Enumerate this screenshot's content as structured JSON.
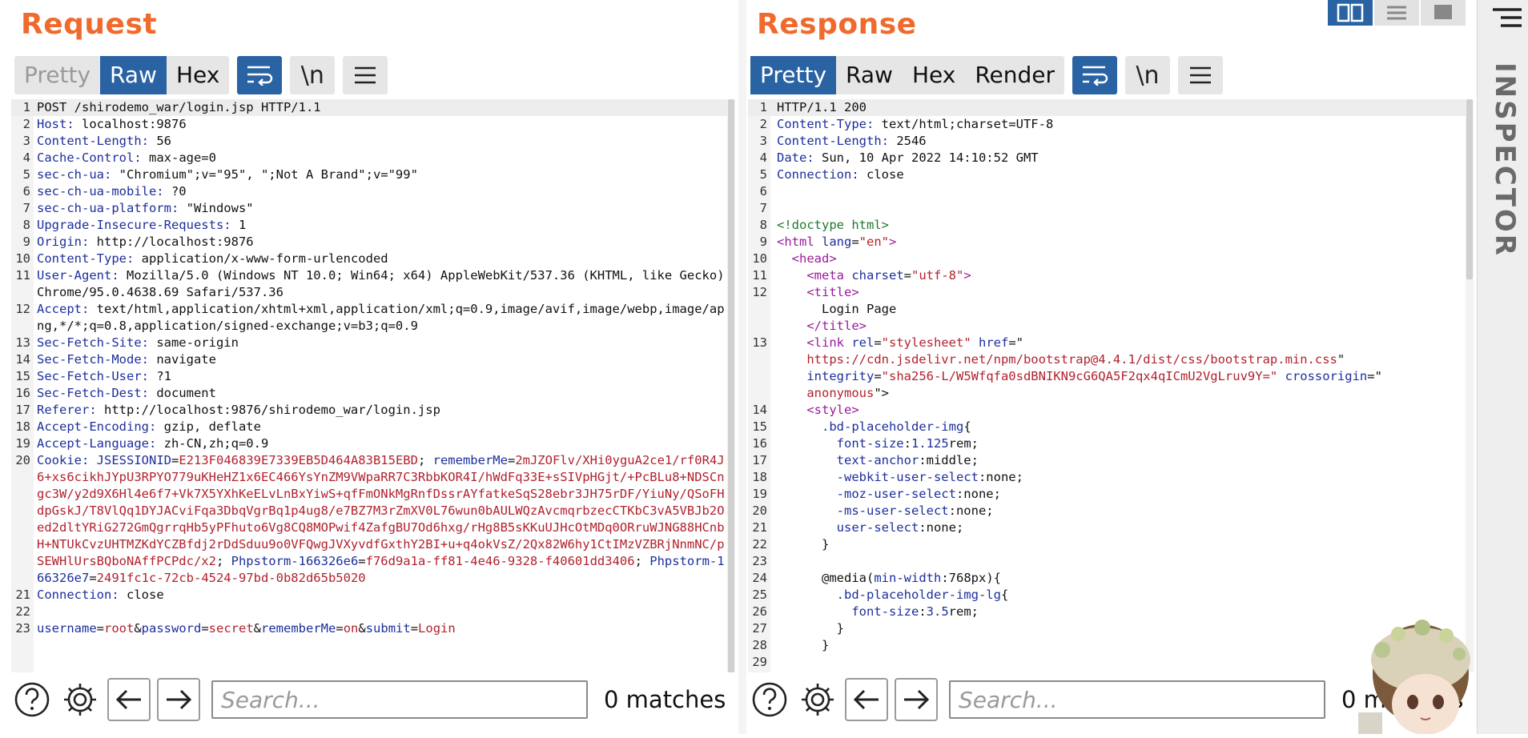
{
  "request": {
    "title": "Request",
    "tabs": [
      {
        "label": "Pretty",
        "state": "disabled"
      },
      {
        "label": "Raw",
        "state": "active"
      },
      {
        "label": "Hex",
        "state": "normal"
      }
    ],
    "newline_label": "\\n",
    "search_placeholder": "Search...",
    "matches": "0 matches"
  },
  "response": {
    "title": "Response",
    "tabs": [
      {
        "label": "Pretty",
        "state": "active"
      },
      {
        "label": "Raw",
        "state": "normal"
      },
      {
        "label": "Hex",
        "state": "normal"
      },
      {
        "label": "Render",
        "state": "normal"
      }
    ],
    "newline_label": "\\n",
    "search_placeholder": "Search...",
    "matches": "0 matches"
  },
  "inspector": {
    "label": "INSPECTOR"
  },
  "request_lines": [
    {
      "n": "1",
      "segs": [
        [
          "v",
          "POST /shirodemo_war/login.jsp HTTP/1.1"
        ]
      ]
    },
    {
      "n": "2",
      "segs": [
        [
          "k",
          "Host:"
        ],
        [
          "v",
          " localhost:9876"
        ]
      ]
    },
    {
      "n": "3",
      "segs": [
        [
          "k",
          "Content-Length:"
        ],
        [
          "v",
          " 56"
        ]
      ]
    },
    {
      "n": "4",
      "segs": [
        [
          "k",
          "Cache-Control:"
        ],
        [
          "v",
          " max-age=0"
        ]
      ]
    },
    {
      "n": "5",
      "segs": [
        [
          "k",
          "sec-ch-ua:"
        ],
        [
          "v",
          " \"Chromium\";v=\"95\", \";Not A Brand\";v=\"99\""
        ]
      ]
    },
    {
      "n": "6",
      "segs": [
        [
          "k",
          "sec-ch-ua-mobile:"
        ],
        [
          "v",
          " ?0"
        ]
      ]
    },
    {
      "n": "7",
      "segs": [
        [
          "k",
          "sec-ch-ua-platform:"
        ],
        [
          "v",
          " \"Windows\""
        ]
      ]
    },
    {
      "n": "8",
      "segs": [
        [
          "k",
          "Upgrade-Insecure-Requests:"
        ],
        [
          "v",
          " 1"
        ]
      ]
    },
    {
      "n": "9",
      "segs": [
        [
          "k",
          "Origin:"
        ],
        [
          "v",
          " http://localhost:9876"
        ]
      ]
    },
    {
      "n": "10",
      "segs": [
        [
          "k",
          "Content-Type:"
        ],
        [
          "v",
          " application/x-www-form-urlencoded"
        ]
      ]
    },
    {
      "n": "11",
      "segs": [
        [
          "k",
          "User-Agent:"
        ],
        [
          "v",
          " Mozilla/5.0 (Windows NT 10.0; Win64; x64) AppleWebKit/537.36 (KHTML, like Gecko) Chrome/95.0.4638.69 Safari/537.36"
        ]
      ]
    },
    {
      "n": "12",
      "segs": [
        [
          "k",
          "Accept:"
        ],
        [
          "v",
          " text/html,application/xhtml+xml,application/xml;q=0.9,image/avif,image/webp,image/apng,*/*;q=0.8,application/signed-exchange;v=b3;q=0.9"
        ]
      ]
    },
    {
      "n": "13",
      "segs": [
        [
          "k",
          "Sec-Fetch-Site:"
        ],
        [
          "v",
          " same-origin"
        ]
      ]
    },
    {
      "n": "14",
      "segs": [
        [
          "k",
          "Sec-Fetch-Mode:"
        ],
        [
          "v",
          " navigate"
        ]
      ]
    },
    {
      "n": "15",
      "segs": [
        [
          "k",
          "Sec-Fetch-User:"
        ],
        [
          "v",
          " ?1"
        ]
      ]
    },
    {
      "n": "16",
      "segs": [
        [
          "k",
          "Sec-Fetch-Dest:"
        ],
        [
          "v",
          " document"
        ]
      ]
    },
    {
      "n": "17",
      "segs": [
        [
          "k",
          "Referer:"
        ],
        [
          "v",
          " http://localhost:9876/shirodemo_war/login.jsp"
        ]
      ]
    },
    {
      "n": "18",
      "segs": [
        [
          "k",
          "Accept-Encoding:"
        ],
        [
          "v",
          " gzip, deflate"
        ]
      ]
    },
    {
      "n": "19",
      "segs": [
        [
          "k",
          "Accept-Language:"
        ],
        [
          "v",
          " zh-CN,zh;q=0.9"
        ]
      ]
    },
    {
      "n": "20",
      "segs": [
        [
          "k",
          "Cookie:"
        ],
        [
          "v",
          " "
        ],
        [
          "ck",
          "JSESSIONID"
        ],
        [
          "v",
          "="
        ],
        [
          "cv",
          "E213F046839E7339EB5D464A83B15EBD"
        ],
        [
          "v",
          "; "
        ],
        [
          "ck",
          "rememberMe"
        ],
        [
          "v",
          "="
        ],
        [
          "cv",
          "2mJZOFlv/XHi0yguA2ce1/rf0R4J6+xs6cikhJYpU3RPYO779uKHeHZ1x6EC466YsYnZM9VWpaRR7C3RbbKOR4I/hWdFq33E+sSIVpHGjt/+PcBLu8+NDSCngc3W/y2d9X6Hl4e6f7+Vk7X5YXhKeELvLnBxYiwS+qfFmONkMgRnfDssrAYfatkeSqS28ebr3JH75rDF/YiuNy/QSoFHdpGskJ/T8VlQq1DYJACviFqa3DbqVgrBq1p4ug8/e7BZ7M3rZmXV0L76wun0bAULWQzAvcmqrbzecCTKbC3vA5VBJb2Oed2dltYRiG272GmQgrrqHb5yPFhuto6Vg8CQ8MOPwif4ZafgBU7Od6hxg/rHg8B5sKKuUJHcOtMDq0ORruWJNG88HCnbH+NTUkCvzUHTMZKdYCZBfdj2rDdSduu9o0VFQwgJVXyvdfGxthY2BI+u+q4okVsZ/2Qx82W6hy1CtIMzVZBRjNnmNC/pSEWHlUrsBQboNAffPCPdc/x2"
        ],
        [
          "v",
          "; "
        ],
        [
          "ck",
          "Phpstorm-166326e6"
        ],
        [
          "v",
          "="
        ],
        [
          "cv",
          "f76d9a1a-ff81-4e46-9328-f40601dd3406"
        ],
        [
          "v",
          "; "
        ],
        [
          "ck",
          "Phpstorm-166326e7"
        ],
        [
          "v",
          "="
        ],
        [
          "cv",
          "2491fc1c-72cb-4524-97bd-0b82d65b5020"
        ]
      ]
    },
    {
      "n": "21",
      "segs": [
        [
          "k",
          "Connection:"
        ],
        [
          "v",
          " close"
        ]
      ]
    },
    {
      "n": "22",
      "segs": [
        [
          "v",
          ""
        ]
      ]
    },
    {
      "n": "23",
      "segs": [
        [
          "ck",
          "username"
        ],
        [
          "v",
          "="
        ],
        [
          "cv",
          "root"
        ],
        [
          "v",
          "&"
        ],
        [
          "ck",
          "password"
        ],
        [
          "v",
          "="
        ],
        [
          "cv",
          "secret"
        ],
        [
          "v",
          "&"
        ],
        [
          "ck",
          "rememberMe"
        ],
        [
          "v",
          "="
        ],
        [
          "cv",
          "on"
        ],
        [
          "v",
          "&"
        ],
        [
          "ck",
          "submit"
        ],
        [
          "v",
          "="
        ],
        [
          "cv",
          "Login"
        ]
      ]
    }
  ],
  "response_lines": [
    {
      "n": "1",
      "segs": [
        [
          "v",
          "HTTP/1.1 200"
        ]
      ]
    },
    {
      "n": "2",
      "segs": [
        [
          "k",
          "Content-Type:"
        ],
        [
          "v",
          " text/html;charset=UTF-8"
        ]
      ]
    },
    {
      "n": "3",
      "segs": [
        [
          "k",
          "Content-Length:"
        ],
        [
          "v",
          " 2546"
        ]
      ]
    },
    {
      "n": "4",
      "segs": [
        [
          "k",
          "Date:"
        ],
        [
          "v",
          " Sun, 10 Apr 2022 14:10:52 GMT"
        ]
      ]
    },
    {
      "n": "5",
      "segs": [
        [
          "k",
          "Connection:"
        ],
        [
          "v",
          " close"
        ]
      ]
    },
    {
      "n": "6",
      "segs": [
        [
          "v",
          ""
        ]
      ]
    },
    {
      "n": "7",
      "segs": [
        [
          "v",
          ""
        ]
      ]
    },
    {
      "n": "8",
      "segs": [
        [
          "doc",
          "<!doctype html>"
        ]
      ]
    },
    {
      "n": "9",
      "segs": [
        [
          "tag",
          "<html "
        ],
        [
          "attr",
          "lang"
        ],
        [
          "txt",
          "="
        ],
        [
          "aval",
          "\"en\""
        ],
        [
          "tag",
          ">"
        ]
      ]
    },
    {
      "n": "10",
      "segs": [
        [
          "txt",
          "  "
        ],
        [
          "tag",
          "<head>"
        ]
      ]
    },
    {
      "n": "11",
      "segs": [
        [
          "txt",
          "    "
        ],
        [
          "tag",
          "<meta "
        ],
        [
          "attr",
          "charset"
        ],
        [
          "txt",
          "="
        ],
        [
          "aval",
          "\"utf-8\""
        ],
        [
          "tag",
          ">"
        ]
      ]
    },
    {
      "n": "12",
      "segs": [
        [
          "txt",
          "    "
        ],
        [
          "tag",
          "<title>"
        ]
      ]
    },
    {
      "n": "",
      "segs": [
        [
          "txt",
          "      Login Page"
        ]
      ]
    },
    {
      "n": "",
      "segs": [
        [
          "txt",
          "    "
        ],
        [
          "tag",
          "</title>"
        ]
      ]
    },
    {
      "n": "13",
      "segs": [
        [
          "txt",
          "    "
        ],
        [
          "tag",
          "<link "
        ],
        [
          "attr",
          "rel"
        ],
        [
          "txt",
          "="
        ],
        [
          "aval",
          "\"stylesheet\""
        ],
        [
          "txt",
          " "
        ],
        [
          "attr",
          "href"
        ],
        [
          "txt",
          "=\""
        ]
      ]
    },
    {
      "n": "",
      "segs": [
        [
          "aval",
          "    https://cdn.jsdelivr.net/npm/bootstrap@4.4.1/dist/css/bootstrap.min.css"
        ],
        [
          "txt",
          "\""
        ]
      ]
    },
    {
      "n": "",
      "segs": [
        [
          "txt",
          "    "
        ],
        [
          "attr",
          "integrity"
        ],
        [
          "txt",
          "="
        ],
        [
          "aval",
          "\"sha256-L/W5Wfqfa0sdBNIKN9cG6QA5F2qx4qICmU2VgLruv9Y=\""
        ],
        [
          "txt",
          " "
        ],
        [
          "attr",
          "crossorigin"
        ],
        [
          "txt",
          "=\""
        ]
      ]
    },
    {
      "n": "",
      "segs": [
        [
          "aval",
          "    anonymous"
        ],
        [
          "txt",
          "\">"
        ]
      ]
    },
    {
      "n": "14",
      "segs": [
        [
          "txt",
          "    "
        ],
        [
          "tag",
          "<style>"
        ]
      ]
    },
    {
      "n": "15",
      "segs": [
        [
          "txt",
          "      "
        ],
        [
          "cssn",
          ".bd-placeholder-img"
        ],
        [
          "txt",
          "{"
        ]
      ]
    },
    {
      "n": "16",
      "segs": [
        [
          "txt",
          "        "
        ],
        [
          "cssp",
          "font-size"
        ],
        [
          "txt",
          ":"
        ],
        [
          "cssp",
          "1.125"
        ],
        [
          "txt",
          "rem;"
        ]
      ]
    },
    {
      "n": "17",
      "segs": [
        [
          "txt",
          "        "
        ],
        [
          "cssp",
          "text-anchor"
        ],
        [
          "txt",
          ":middle;"
        ]
      ]
    },
    {
      "n": "18",
      "segs": [
        [
          "txt",
          "        "
        ],
        [
          "cssp",
          "-webkit-user-select"
        ],
        [
          "txt",
          ":none;"
        ]
      ]
    },
    {
      "n": "19",
      "segs": [
        [
          "txt",
          "        "
        ],
        [
          "cssp",
          "-moz-user-select"
        ],
        [
          "txt",
          ":none;"
        ]
      ]
    },
    {
      "n": "20",
      "segs": [
        [
          "txt",
          "        "
        ],
        [
          "cssp",
          "-ms-user-select"
        ],
        [
          "txt",
          ":none;"
        ]
      ]
    },
    {
      "n": "21",
      "segs": [
        [
          "txt",
          "        "
        ],
        [
          "cssp",
          "user-select"
        ],
        [
          "txt",
          ":none;"
        ]
      ]
    },
    {
      "n": "22",
      "segs": [
        [
          "txt",
          "      }"
        ]
      ]
    },
    {
      "n": "23",
      "segs": [
        [
          "v",
          ""
        ]
      ]
    },
    {
      "n": "24",
      "segs": [
        [
          "txt",
          "      @media("
        ],
        [
          "cssp",
          "min-width"
        ],
        [
          "txt",
          ":768px){"
        ]
      ]
    },
    {
      "n": "25",
      "segs": [
        [
          "txt",
          "        "
        ],
        [
          "cssn",
          ".bd-placeholder-img-lg"
        ],
        [
          "txt",
          "{"
        ]
      ]
    },
    {
      "n": "26",
      "segs": [
        [
          "txt",
          "          "
        ],
        [
          "cssp",
          "font-size"
        ],
        [
          "txt",
          ":"
        ],
        [
          "cssp",
          "3.5"
        ],
        [
          "txt",
          "rem;"
        ]
      ]
    },
    {
      "n": "27",
      "segs": [
        [
          "txt",
          "        }"
        ]
      ]
    },
    {
      "n": "28",
      "segs": [
        [
          "txt",
          "      }"
        ]
      ]
    },
    {
      "n": "29",
      "segs": [
        [
          "v",
          ""
        ]
      ]
    }
  ]
}
